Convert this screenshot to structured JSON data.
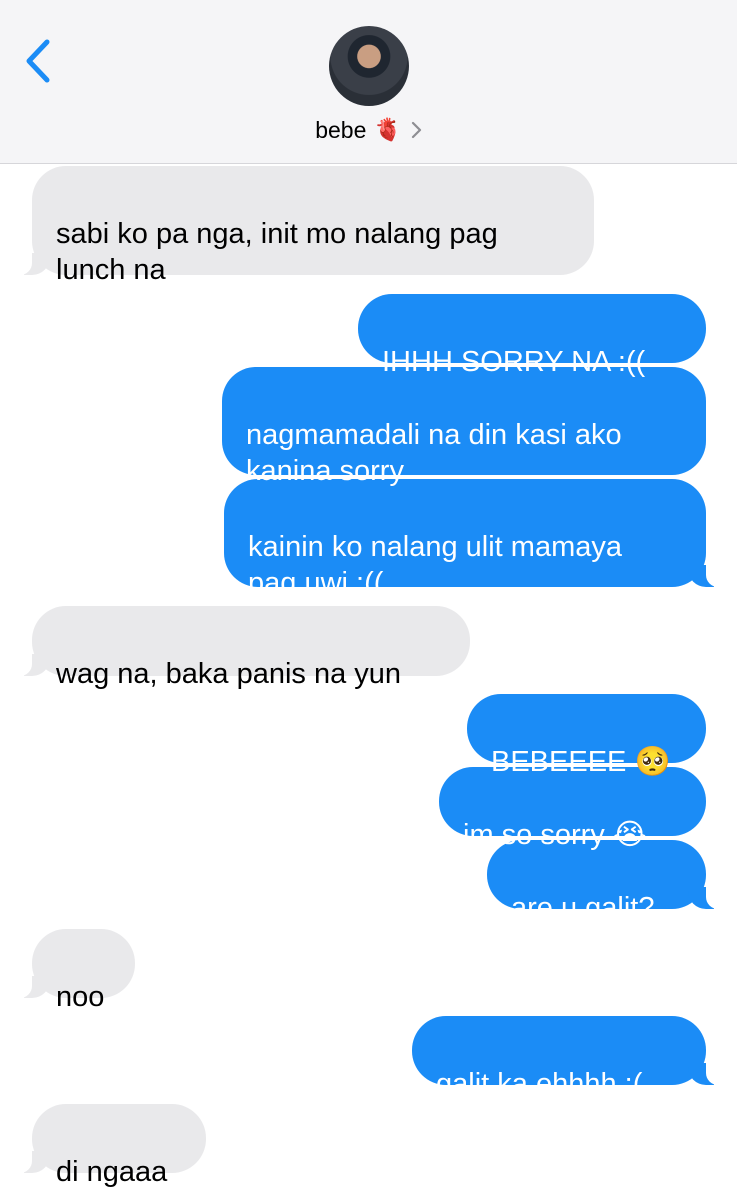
{
  "header": {
    "contact_name": "bebe",
    "heart_emoji": "🫀",
    "back_icon": "chevron-left-icon",
    "accent_color": "#1b8cf6"
  },
  "messages": [
    {
      "from": "them",
      "text": "sabi ko pa nga, init mo nalang pag\nlunch na"
    },
    {
      "from": "me",
      "text": "IHHH SORRY NA :(("
    },
    {
      "from": "me",
      "text": "nagmamadali na din kasi ako\nkanina sorry"
    },
    {
      "from": "me",
      "text": "kainin ko nalang ulit mamaya\npag uwi :(("
    },
    {
      "from": "them",
      "text": "wag na, baka panis na yun"
    },
    {
      "from": "me",
      "text": "BEBEEEE 🥺"
    },
    {
      "from": "me",
      "text": "im so sorry 😭"
    },
    {
      "from": "me",
      "text": "are u galit?"
    },
    {
      "from": "them",
      "text": "noo"
    },
    {
      "from": "me",
      "text": "galit ka ehhhh :("
    },
    {
      "from": "them",
      "text": "di ngaaa"
    }
  ]
}
